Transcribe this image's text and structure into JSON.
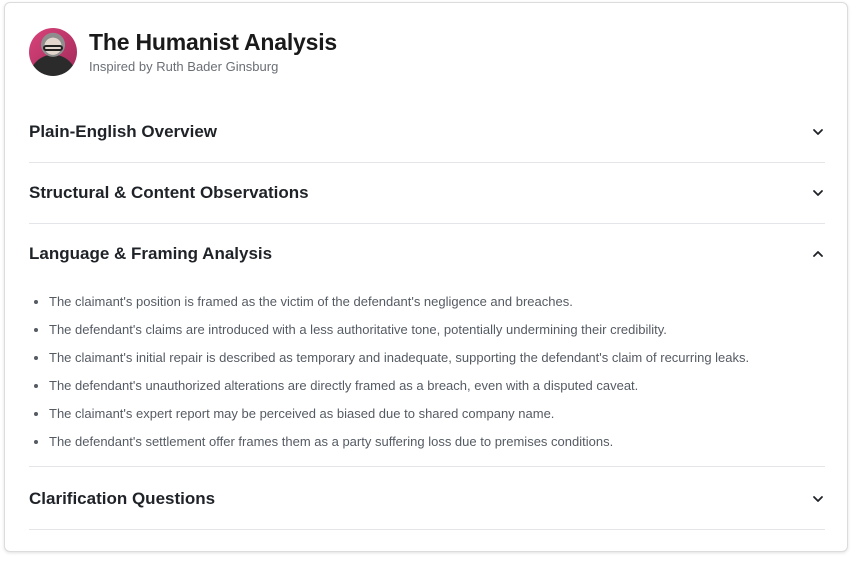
{
  "header": {
    "title": "The Humanist Analysis",
    "subtitle": "Inspired by Ruth Bader Ginsburg"
  },
  "sections": [
    {
      "title": "Plain-English Overview",
      "expanded": false,
      "icon": "chevron-down-icon"
    },
    {
      "title": "Structural & Content Observations",
      "expanded": false,
      "icon": "chevron-down-icon"
    },
    {
      "title": "Language & Framing Analysis",
      "expanded": true,
      "icon": "chevron-up-icon",
      "items": [
        "The claimant's position is framed as the victim of the defendant's negligence and breaches.",
        "The defendant's claims are introduced with a less authoritative tone, potentially undermining their credibility.",
        "The claimant's initial repair is described as temporary and inadequate, supporting the defendant's claim of recurring leaks.",
        "The defendant's unauthorized alterations are directly framed as a breach, even with a disputed caveat.",
        "The claimant's expert report may be perceived as biased due to shared company name.",
        "The defendant's settlement offer frames them as a party suffering loss due to premises conditions."
      ]
    },
    {
      "title": "Clarification Questions",
      "expanded": false,
      "icon": "chevron-down-icon"
    }
  ],
  "colors": {
    "title": "#1a1a1a",
    "subtitle": "#6a6f76",
    "body_text": "#555b63",
    "divider": "#e3e5e8",
    "avatar_bg": "#d9437a"
  }
}
